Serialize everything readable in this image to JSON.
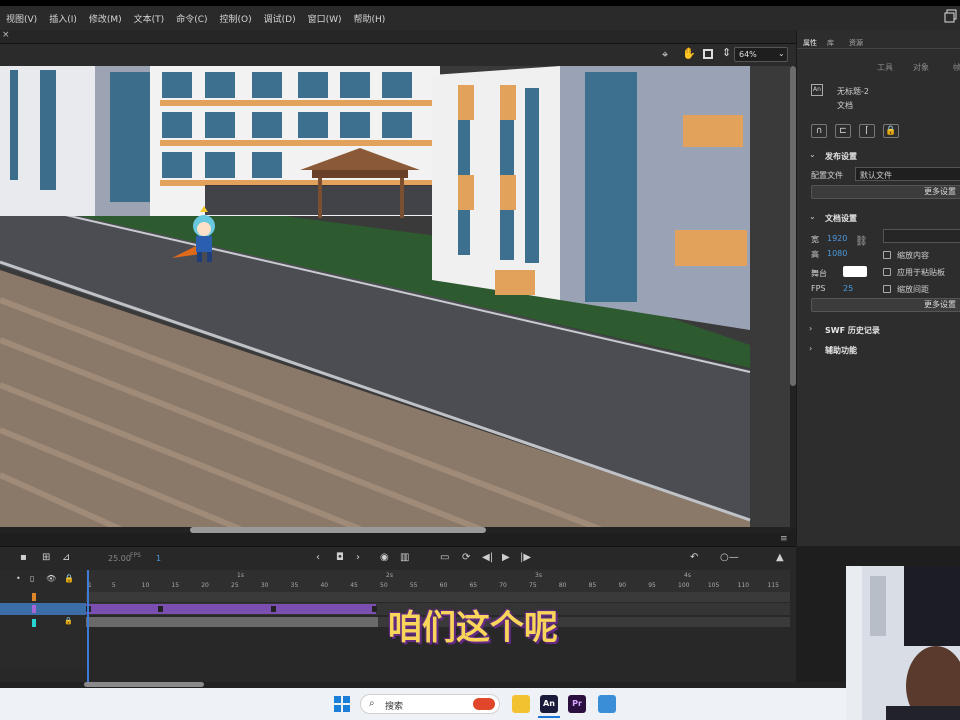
{
  "menu": [
    "视图(V)",
    "插入(I)",
    "修改(M)",
    "文本(T)",
    "命令(C)",
    "控制(O)",
    "调试(D)",
    "窗口(W)",
    "帮助(H)"
  ],
  "doc_tab": {
    "close_label": "×"
  },
  "stagebar": {
    "zoom": "64%"
  },
  "panel": {
    "tabs": [
      "属性",
      "库",
      "资源"
    ],
    "subtabs": [
      "工具",
      "对象",
      "帧"
    ],
    "doc_title": "无标题-2",
    "doc_type": "文档",
    "publish": {
      "heading": "发布设置",
      "profile_label": "配置文件",
      "profile_value": "默认文件",
      "more_label": "更多设置"
    },
    "doc_settings": {
      "heading": "文档设置",
      "width_label": "宽",
      "width_value": "1920",
      "height_label": "高",
      "height_value": "1080",
      "stage_label": "舞台",
      "fps_label": "FPS",
      "fps_value": "25",
      "scale_content": "缩放内容",
      "apply_pasteboard": "应用于粘贴板",
      "scale_spacing": "缩放间距",
      "more_label": "更多设置"
    },
    "swf_history": "SWF 历史记录",
    "accessibility": "辅助功能"
  },
  "timeline": {
    "fps": "25.00",
    "fps_unit": "FPS",
    "frame": "1",
    "ruler_secs": [
      "1s",
      "2s",
      "3s",
      "4s"
    ],
    "ruler_nums": [
      "1",
      "5",
      "10",
      "15",
      "20",
      "25",
      "30",
      "35",
      "40",
      "45",
      "50",
      "55",
      "60",
      "65",
      "70",
      "75",
      "80",
      "85",
      "90",
      "95",
      "100",
      "105",
      "110",
      "115"
    ]
  },
  "subtitle": "咱们这个呢",
  "taskbar": {
    "search_placeholder": "搜索",
    "an_label": "An",
    "pr_label": "Pr"
  },
  "colors": {
    "accent": "#4a9be0",
    "layer_selected": "#3b6ea6",
    "tween": "#7a4fb0"
  }
}
